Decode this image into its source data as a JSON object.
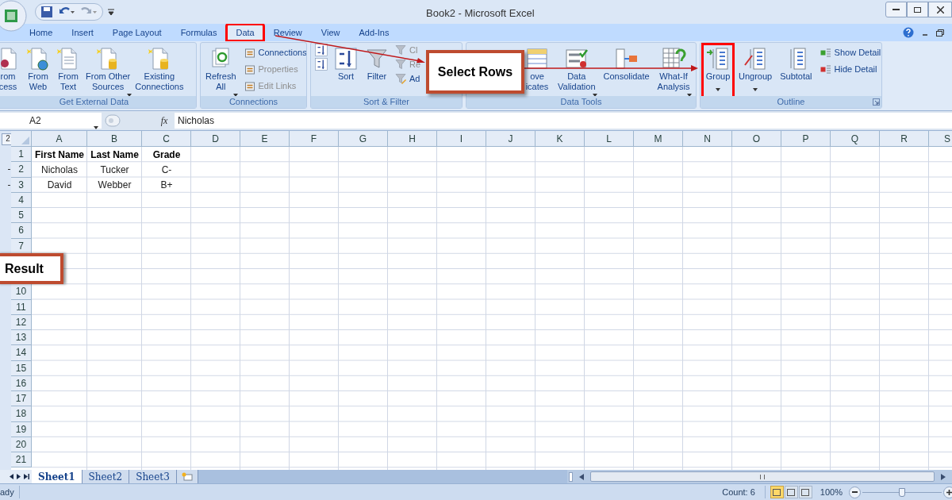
{
  "window": {
    "title": "Book2 - Microsoft Excel"
  },
  "ribbon_tabs": [
    {
      "label": "Home",
      "selected": false,
      "highlighted": false
    },
    {
      "label": "Insert",
      "selected": false,
      "highlighted": false
    },
    {
      "label": "Page Layout",
      "selected": false,
      "highlighted": false
    },
    {
      "label": "Formulas",
      "selected": false,
      "highlighted": false
    },
    {
      "label": "Data",
      "selected": true,
      "highlighted": true
    },
    {
      "label": "Review",
      "selected": false,
      "highlighted": false
    },
    {
      "label": "View",
      "selected": false,
      "highlighted": false
    },
    {
      "label": "Add-Ins",
      "selected": false,
      "highlighted": false
    }
  ],
  "ribbon_groups": [
    {
      "label": "Get External Data",
      "buttons": [
        {
          "kind": "large",
          "lines": [
            "rom",
            "cess"
          ],
          "dropdown": false,
          "disabled": false,
          "highlighted": false
        },
        {
          "kind": "large",
          "lines": [
            "From",
            "Web"
          ],
          "dropdown": false,
          "disabled": false,
          "highlighted": false
        },
        {
          "kind": "large",
          "lines": [
            "From",
            "Text"
          ],
          "dropdown": false,
          "disabled": false,
          "highlighted": false
        },
        {
          "kind": "large",
          "lines": [
            "From Other",
            "Sources"
          ],
          "dropdown": true,
          "disabled": false,
          "highlighted": false
        },
        {
          "kind": "large",
          "lines": [
            "Existing",
            "Connections"
          ],
          "dropdown": false,
          "disabled": false,
          "highlighted": false
        }
      ]
    },
    {
      "label": "Connections",
      "buttons": [
        {
          "kind": "large",
          "lines": [
            "Refresh",
            "All"
          ],
          "dropdown": true,
          "disabled": false,
          "highlighted": false
        },
        {
          "kind": "small",
          "lines": [
            "Connections"
          ],
          "disabled": false
        },
        {
          "kind": "small",
          "lines": [
            "Properties"
          ],
          "disabled": true
        },
        {
          "kind": "small",
          "lines": [
            "Edit Links"
          ],
          "disabled": true
        }
      ]
    },
    {
      "label": "Sort & Filter",
      "buttons": [
        {
          "kind": "icon",
          "disabled": false
        },
        {
          "kind": "icon",
          "disabled": false
        },
        {
          "kind": "large",
          "lines": [
            "Sort"
          ],
          "dropdown": false,
          "disabled": false,
          "highlighted": false
        },
        {
          "kind": "large",
          "lines": [
            "Filter"
          ],
          "dropdown": false,
          "disabled": false,
          "highlighted": false
        },
        {
          "kind": "small",
          "lines": [
            "Cl"
          ],
          "disabled": true
        },
        {
          "kind": "small",
          "lines": [
            "Re"
          ],
          "disabled": true
        },
        {
          "kind": "small",
          "lines": [
            "Ad"
          ],
          "disabled": false
        }
      ]
    },
    {
      "label": "Data Tools",
      "buttons": [
        {
          "kind": "large",
          "lines": [
            "ove",
            "icates"
          ],
          "dropdown": false,
          "disabled": false,
          "highlighted": false
        },
        {
          "kind": "large",
          "lines": [
            "Data",
            "Validation"
          ],
          "dropdown": true,
          "disabled": false,
          "highlighted": false
        },
        {
          "kind": "large",
          "lines": [
            "Consolidate"
          ],
          "dropdown": false,
          "disabled": false,
          "highlighted": false
        },
        {
          "kind": "large",
          "lines": [
            "What-If",
            "Analysis"
          ],
          "dropdown": true,
          "disabled": false,
          "highlighted": false
        }
      ]
    },
    {
      "label": "Outline",
      "buttons": [
        {
          "kind": "large",
          "lines": [
            "Group"
          ],
          "dropdown": true,
          "disabled": false,
          "highlighted": true
        },
        {
          "kind": "large",
          "lines": [
            "Ungroup"
          ],
          "dropdown": true,
          "disabled": false,
          "highlighted": false
        },
        {
          "kind": "large",
          "lines": [
            "Subtotal"
          ],
          "dropdown": false,
          "disabled": false,
          "highlighted": false
        },
        {
          "kind": "small",
          "lines": [
            "Show Detail"
          ],
          "disabled": false
        },
        {
          "kind": "small",
          "lines": [
            "Hide Detail"
          ],
          "disabled": false
        }
      ]
    }
  ],
  "formula_bar": {
    "name_box": "A2",
    "function_label": "fx",
    "value": "Nicholas"
  },
  "outline_level": "2",
  "columns": [
    "A",
    "B",
    "C",
    "D",
    "E",
    "F",
    "G",
    "H",
    "I",
    "J",
    "K",
    "L",
    "M",
    "N",
    "O",
    "P",
    "Q",
    "R",
    "S"
  ],
  "rows": [
    {
      "number": "1",
      "bold": true,
      "cells": [
        "First Name",
        "Last Name",
        "Grade"
      ]
    },
    {
      "number": "2",
      "bold": false,
      "grouped": true,
      "cells": [
        "Nicholas",
        "Tucker",
        "C-"
      ]
    },
    {
      "number": "3",
      "bold": false,
      "grouped": true,
      "cells": [
        "David",
        "Webber",
        "B+"
      ]
    },
    {
      "number": "4"
    },
    {
      "number": "5"
    },
    {
      "number": "6"
    },
    {
      "number": "7"
    },
    {},
    {},
    {
      "number": "10"
    },
    {
      "number": "11"
    },
    {
      "number": "12"
    },
    {
      "number": "13"
    },
    {
      "number": "14"
    },
    {
      "number": "15"
    },
    {
      "number": "16"
    },
    {
      "number": "17"
    },
    {
      "number": "18"
    },
    {
      "number": "19"
    },
    {
      "number": "20"
    },
    {
      "number": "21"
    }
  ],
  "sheet_tabs": [
    {
      "label": "Sheet1",
      "selected": true
    },
    {
      "label": "Sheet2",
      "selected": false
    },
    {
      "label": "Sheet3",
      "selected": false
    }
  ],
  "status_bar": {
    "mode": "ady",
    "count": "Count: 6",
    "views": [
      {
        "selected": true
      },
      {
        "selected": false
      },
      {
        "selected": false
      }
    ],
    "zoom": "100%",
    "zoom_level": {
      "level": 0.5
    }
  },
  "annotations": [
    {
      "text": "Select Rows"
    },
    {
      "text": "Result"
    }
  ]
}
